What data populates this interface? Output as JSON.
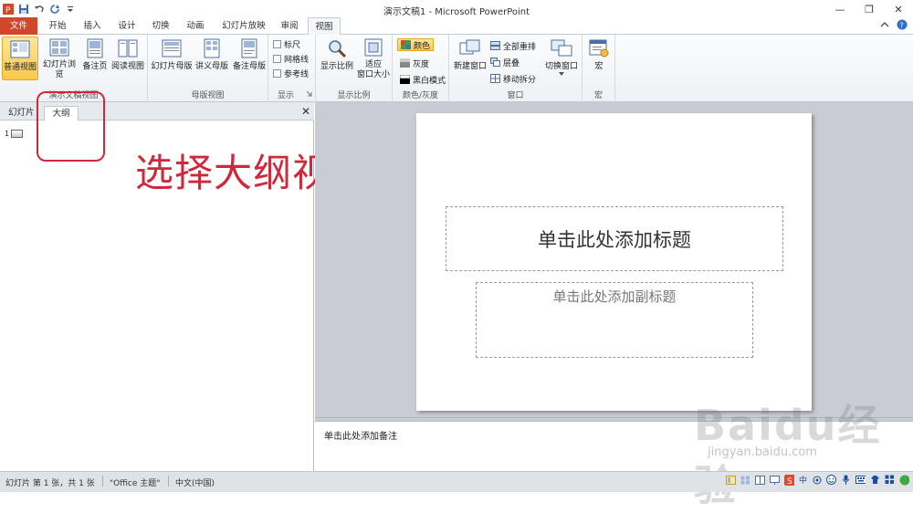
{
  "window": {
    "title": "演示文稿1 - Microsoft PowerPoint",
    "minimize": "—",
    "restore": "❐",
    "close": "✕"
  },
  "tabs": [
    {
      "label": "文件"
    },
    {
      "label": "开始"
    },
    {
      "label": "插入"
    },
    {
      "label": "设计"
    },
    {
      "label": "切换"
    },
    {
      "label": "动画"
    },
    {
      "label": "幻灯片放映"
    },
    {
      "label": "审阅"
    },
    {
      "label": "视图"
    }
  ],
  "ribbon": {
    "pres_views": {
      "label": "演示文稿视图",
      "normal": "普通视图",
      "sorter": "幻灯片浏览",
      "notes_page": "备注页",
      "reading": "阅读视图"
    },
    "master_views": {
      "label": "母版视图",
      "slide_master": "幻灯片母版",
      "handout_master": "讲义母版",
      "notes_master": "备注母版"
    },
    "show": {
      "label": "显示",
      "ruler": "标尺",
      "gridlines": "网格线",
      "guides": "参考线"
    },
    "zoom": {
      "label": "显示比例",
      "zoom": "显示比例",
      "fit_line1": "适应",
      "fit_line2": "窗口大小"
    },
    "color": {
      "label": "颜色/灰度",
      "color": "颜色",
      "grayscale": "灰度",
      "bw": "黑白模式"
    },
    "window": {
      "label": "窗口",
      "new_window": "新建窗口",
      "arrange_all": "全部重排",
      "cascade": "层叠",
      "move_split": "移动拆分",
      "switch_windows": "切换窗口"
    },
    "macros": {
      "label": "宏",
      "macros": "宏"
    }
  },
  "left_pane": {
    "tab_slides": "幻灯片",
    "tab_outline": "大纲",
    "slide_number": "1"
  },
  "annotation": "选择大纲视图",
  "slide": {
    "title_placeholder": "单击此处添加标题",
    "subtitle_placeholder": "单击此处添加副标题"
  },
  "notes_placeholder": "单击此处添加备注",
  "status": {
    "slide_info": "幻灯片 第 1 张，共 1 张",
    "theme": "\"Office 主题\"",
    "language": "中文(中国)"
  },
  "tray": {
    "ime": "中"
  },
  "watermark": {
    "brand": "Baidu经验",
    "url": "jingyan.baidu.com"
  },
  "colors": {
    "file_tab": "#d24726",
    "selected": "#f9c94c",
    "annotation": "#d0283a"
  }
}
